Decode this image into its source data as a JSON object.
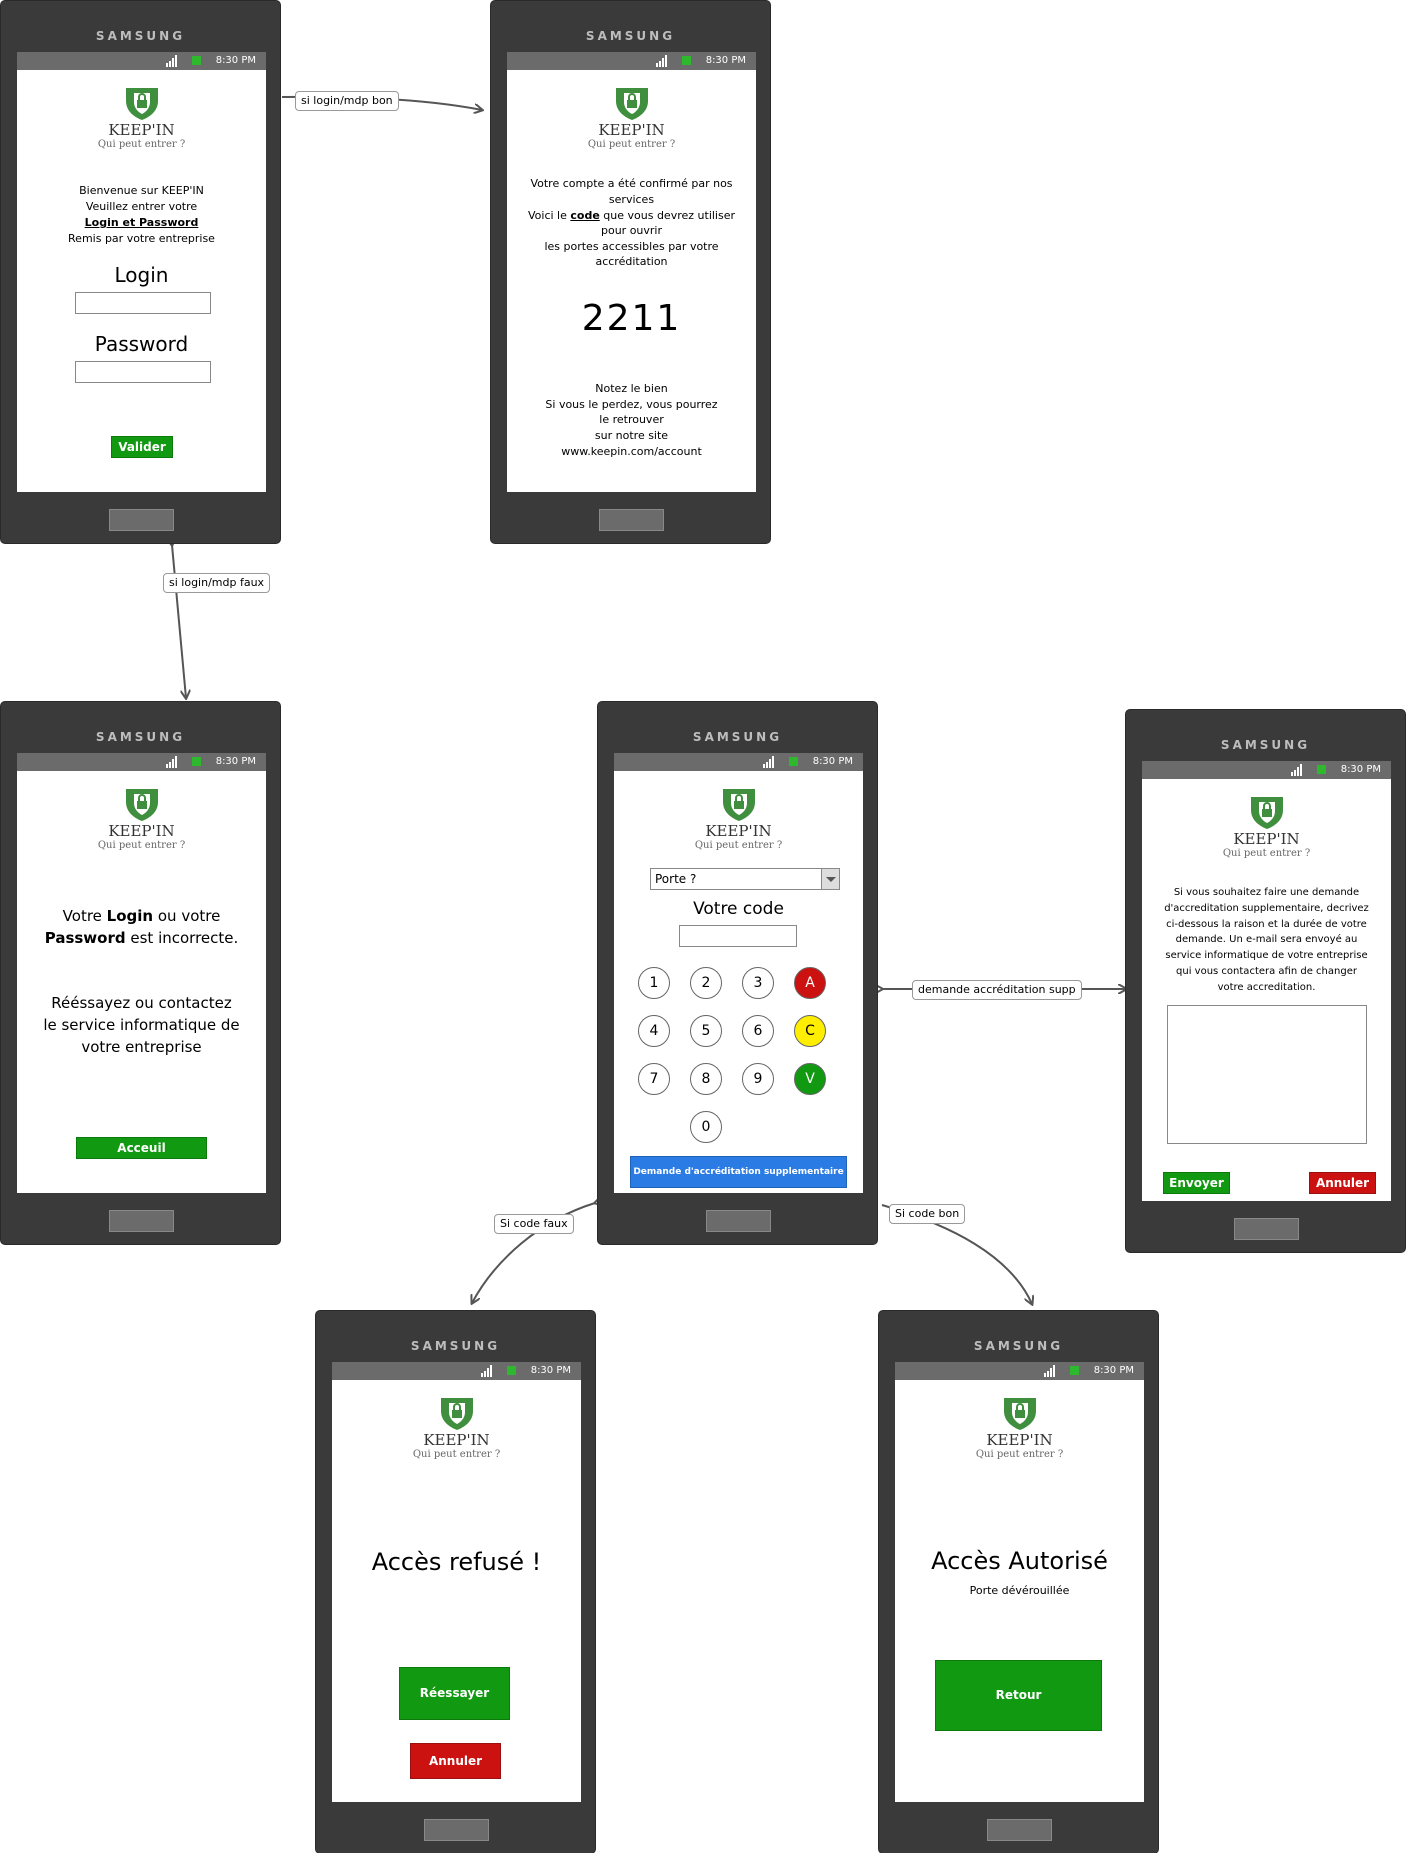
{
  "device": {
    "brand": "SAMSUNG",
    "time": "8:30 PM"
  },
  "app": {
    "name": "KEEP'IN",
    "tagline": "Qui peut entrer ?"
  },
  "screens": {
    "login": {
      "line1": "Bienvenue sur KEEP'IN",
      "line2": "Veuillez entrer votre",
      "line3": "Login et Password",
      "line4": "Remis par votre entreprise",
      "login_label": "Login",
      "password_label": "Password",
      "submit": "Valider"
    },
    "confirm": {
      "line1": "Votre compte a été confirmé par nos",
      "line2": "services",
      "line3_pre": "Voici le ",
      "line3_code": "code",
      "line3_post": " que vous devrez utiliser",
      "line4": "pour ouvrir",
      "line5": "les portes accessibles par votre",
      "line6": "accréditation",
      "code": "2211",
      "note1": "Notez le bien",
      "note2": "Si vous le perdez, vous pourrez",
      "note3": "le retrouver",
      "note4": "sur notre site",
      "note5": "www.keepin.com/account"
    },
    "error": {
      "m1_pre": "Votre ",
      "m1_login": "Login",
      "m1_post": " ou votre",
      "m2_pw": "Password",
      "m2_post": " est incorrecte.",
      "r1": "Rééssayez ou contactez",
      "r2": "le service informatique de",
      "r3": "votre entreprise",
      "button": "Acceuil"
    },
    "keypad": {
      "door_select": "Porte ?",
      "code_label": "Votre code",
      "keys": [
        "1",
        "2",
        "3",
        "A",
        "4",
        "5",
        "6",
        "C",
        "7",
        "8",
        "9",
        "V",
        "0"
      ],
      "request_button": "Demande d'accréditation supplementaire",
      "colors": {
        "A": "#cc1111",
        "C": "#ffee00",
        "V": "#119911"
      }
    },
    "request": {
      "l1": "Si vous souhaitez faire une demande",
      "l2": "d'accreditation supplementaire, decrivez",
      "l3": "ci-dessous la raison et la durée de votre",
      "l4": "demande. Un e-mail sera envoyé au",
      "l5": "service informatique de votre entreprise",
      "l6": "qui vous contactera afin de changer",
      "l7": "votre accreditation.",
      "send": "Envoyer",
      "cancel": "Annuler"
    },
    "denied": {
      "title": "Accès refusé !",
      "retry": "Réessayer",
      "cancel": "Annuler"
    },
    "granted": {
      "title": "Accès Autorisé",
      "subtitle": "Porte dévérouillée",
      "back": "Retour"
    }
  },
  "transitions": {
    "login_ok": "si login/mdp bon",
    "login_bad": "si login/mdp faux",
    "extra_request": "demande accréditation supp",
    "code_bad": "Si code faux",
    "code_ok": "Si code bon"
  },
  "colors": {
    "phone": "#3a3a3a",
    "statusbar": "#6b6b6b",
    "green": "#119911",
    "red": "#cc1111",
    "blue": "#2a7be4"
  }
}
